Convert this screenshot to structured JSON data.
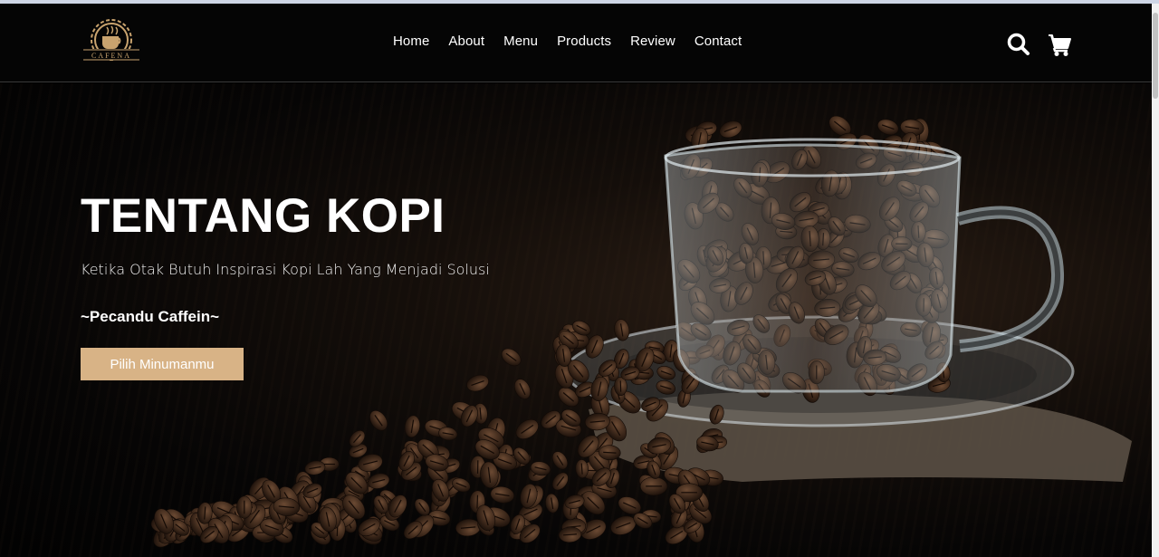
{
  "brand": {
    "logo_text": "CAFENA",
    "accent": "#d8b386"
  },
  "nav": {
    "items": [
      {
        "label": "Home"
      },
      {
        "label": "About"
      },
      {
        "label": "Menu"
      },
      {
        "label": "Products"
      },
      {
        "label": "Review"
      },
      {
        "label": "Contact"
      }
    ]
  },
  "icons": {
    "search": "search-icon",
    "cart": "cart-icon"
  },
  "hero": {
    "title": "TENTANG KOPI",
    "subtitle": "Ketika Otak Butuh Inspirasi Kopi Lah Yang Menjadi Solusi",
    "quote": "~Pecandu Caffein~",
    "cta_label": "Pilih Minumanmu"
  }
}
